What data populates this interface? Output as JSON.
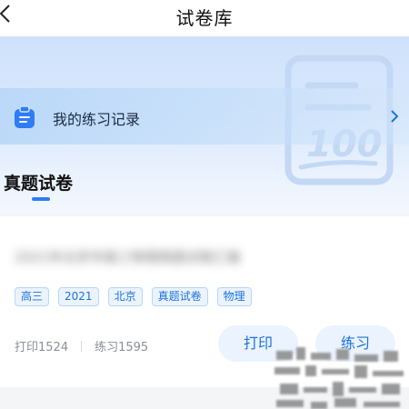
{
  "header": {
    "title": "试卷库"
  },
  "record": {
    "label": "我的练习记录"
  },
  "section": {
    "title": "真题试卷"
  },
  "card": {
    "title": "2021年北京市高三物理真题试卷汇编",
    "tags": [
      "高三",
      "2021",
      "北京",
      "真题试卷",
      "物理"
    ],
    "print_count": "打印1524",
    "practice_count": "练习1595",
    "print_button": "打印",
    "practice_button": "练习"
  },
  "colors": {
    "accent": "#1e73d8",
    "tag_bg": "#eaf3fe",
    "banner": "#cfe2fb"
  }
}
